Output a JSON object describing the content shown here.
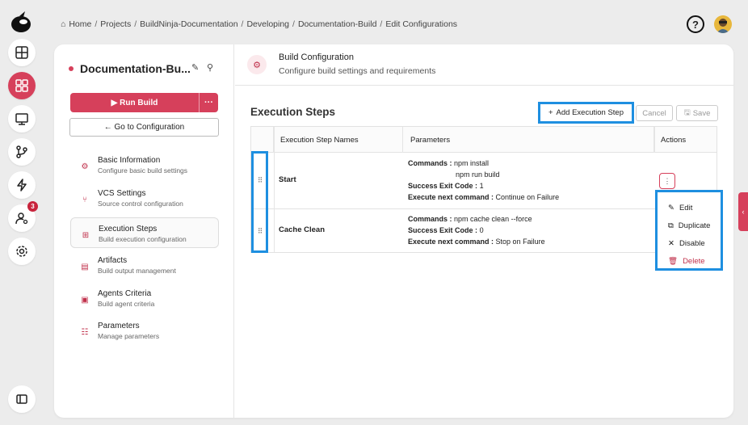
{
  "breadcrumb": [
    "Home",
    "Projects",
    "BuildNinja-Documentation",
    "Developing",
    "Documentation-Build",
    "Edit Configurations"
  ],
  "header": {
    "help_symbol": "?"
  },
  "rail": {
    "notification_count": "3"
  },
  "sidebar": {
    "project_title": "Documentation-Bu...",
    "run_label": "Run Build",
    "run_more": "···",
    "goto_label": "← Go to Configuration",
    "items": [
      {
        "title": "Basic Information",
        "subtitle": "Configure basic build settings",
        "icon": "gear-icon"
      },
      {
        "title": "VCS Settings",
        "subtitle": "Source control configuration",
        "icon": "branch-icon"
      },
      {
        "title": "Execution Steps",
        "subtitle": "Build execution configuration",
        "icon": "steps-icon"
      },
      {
        "title": "Artifacts",
        "subtitle": "Build output management",
        "icon": "file-icon"
      },
      {
        "title": "Agents Criteria",
        "subtitle": "Build agent criteria",
        "icon": "agent-icon"
      },
      {
        "title": "Parameters",
        "subtitle": "Manage parameters",
        "icon": "params-icon"
      }
    ]
  },
  "content": {
    "title": "Build Configuration",
    "subtitle": "Configure build settings and requirements",
    "section_title": "Execution Steps",
    "add_label": "Add Execution Step",
    "cancel_label": "Cancel",
    "save_label": "Save"
  },
  "table": {
    "headers": [
      "Execution Step Names",
      "Parameters",
      "Actions"
    ],
    "rows": [
      {
        "name": "Start",
        "commands_label": "Commands :",
        "commands": [
          "npm install",
          "npm run build"
        ],
        "exit_label": "Success Exit Code :",
        "exit_code": "1",
        "next_label": "Execute next command :",
        "next_value": "Continue on Failure"
      },
      {
        "name": "Cache Clean",
        "commands_label": "Commands :",
        "commands": [
          "npm cache clean --force"
        ],
        "exit_label": "Success Exit Code :",
        "exit_code": "0",
        "next_label": "Execute next command :",
        "next_value": "Stop on Failure"
      }
    ]
  },
  "menu": {
    "items": [
      {
        "label": "Edit",
        "icon": "pencil-icon"
      },
      {
        "label": "Duplicate",
        "icon": "copy-icon"
      },
      {
        "label": "Disable",
        "icon": "x-icon"
      },
      {
        "label": "Delete",
        "icon": "trash-icon"
      }
    ]
  },
  "colors": {
    "accent": "#d6405b",
    "highlight": "#1e8fe0"
  }
}
